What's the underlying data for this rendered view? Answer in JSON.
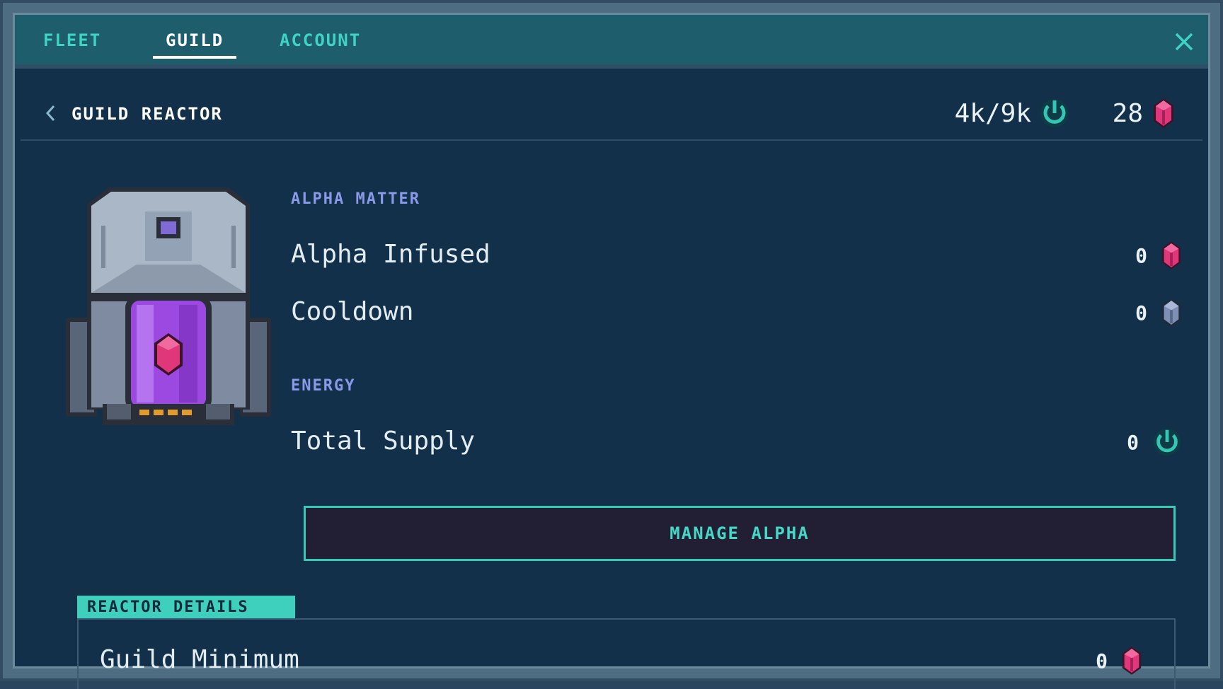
{
  "tabs": [
    {
      "label": "FLEET",
      "active": false
    },
    {
      "label": "GUILD",
      "active": true
    },
    {
      "label": "ACCOUNT",
      "active": false
    }
  ],
  "header": {
    "title": "GUILD REACTOR",
    "energy": "4k/9k",
    "alpha": "28"
  },
  "alpha_matter": {
    "label": "ALPHA MATTER",
    "infused": {
      "label": "Alpha Infused",
      "value": "0"
    },
    "cooldown": {
      "label": "Cooldown",
      "value": "0"
    }
  },
  "energy": {
    "label": "ENERGY",
    "total_supply": {
      "label": "Total Supply",
      "value": "0"
    }
  },
  "manage_button": "MANAGE ALPHA",
  "details": {
    "label": "REACTOR DETAILS",
    "guild_minimum": {
      "label": "Guild Minimum",
      "value": "0"
    }
  },
  "icons": {
    "close": "close-icon",
    "back": "chevron-left-icon",
    "energy": "power-icon",
    "alpha": "alpha-crystal-icon",
    "cooldown": "cooldown-crystal-icon"
  },
  "colors": {
    "accent": "#3fd3c3",
    "background": "#12304a",
    "section_label": "#8a9ae8",
    "alpha_crystal": "#e0367a",
    "button_bg": "#221f35"
  }
}
